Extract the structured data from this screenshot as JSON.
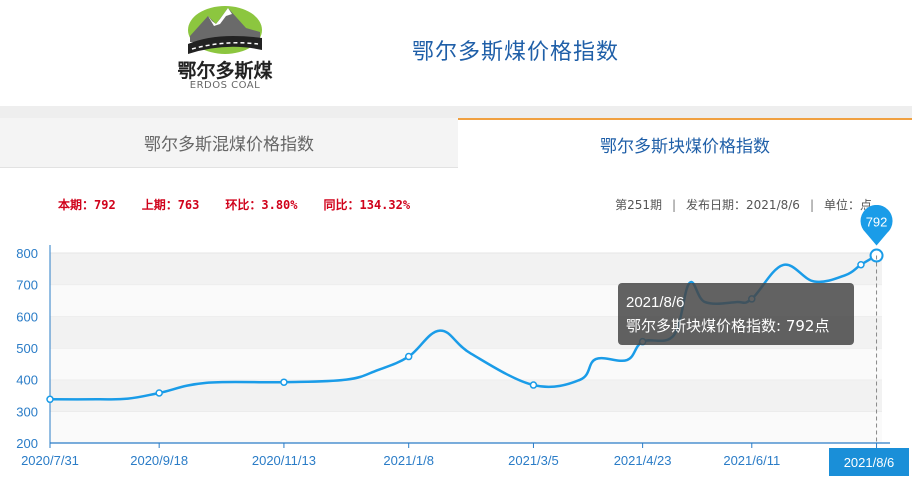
{
  "header": {
    "logo_cn": "鄂尔多斯煤",
    "logo_en": "ERDOS COAL",
    "title": "鄂尔多斯煤价格指数"
  },
  "tabs": [
    {
      "label": "鄂尔多斯混煤价格指数",
      "active": false
    },
    {
      "label": "鄂尔多斯块煤价格指数",
      "active": true
    }
  ],
  "stats": {
    "current": "本期：792",
    "previous": "上期：763",
    "mom": "环比：3.80%",
    "yoy": "同比：134.32%"
  },
  "meta": {
    "period": "第251期",
    "date": "发布日期：2021/8/6",
    "unit": "单位：点"
  },
  "colors": {
    "accent": "#1f5fa8",
    "line": "#1a9ce8",
    "stat_red": "#d0021b",
    "tab_border": "#f0a040"
  },
  "tooltip": {
    "date": "2021/8/6",
    "text": "鄂尔多斯块煤价格指数: 792点"
  },
  "chart_data": {
    "type": "line",
    "title": "",
    "xlabel": "",
    "ylabel": "",
    "ylim": [
      200,
      800
    ],
    "yticks": [
      200,
      300,
      400,
      500,
      600,
      700,
      800
    ],
    "xticks": [
      "2020/7/31",
      "2020/9/18",
      "2020/11/13",
      "2021/1/8",
      "2021/3/5",
      "2021/4/23",
      "2021/6/11",
      "2021/8/6"
    ],
    "grid": true,
    "series": [
      {
        "name": "鄂尔多斯块煤价格指数",
        "x": [
          "2020/7/31",
          "2020/8/21",
          "2020/9/4",
          "2020/9/18",
          "2020/10/9",
          "2020/11/13",
          "2020/12/11",
          "2020/12/25",
          "2021/1/8",
          "2021/1/22",
          "2021/2/5",
          "2021/3/5",
          "2021/3/26",
          "2021/4/2",
          "2021/4/16",
          "2021/4/23",
          "2021/5/7",
          "2021/5/14",
          "2021/5/21",
          "2021/6/4",
          "2021/6/11",
          "2021/6/25",
          "2021/7/9",
          "2021/7/23",
          "2021/7/30",
          "2021/8/6"
        ],
        "values": [
          338,
          338,
          340,
          358,
          390,
          392,
          400,
          430,
          473,
          555,
          482,
          383,
          400,
          465,
          462,
          520,
          540,
          705,
          645,
          645,
          655,
          762,
          710,
          730,
          763,
          792
        ]
      }
    ],
    "highlight": {
      "label": "792",
      "x_label": "2021/8/6"
    }
  }
}
